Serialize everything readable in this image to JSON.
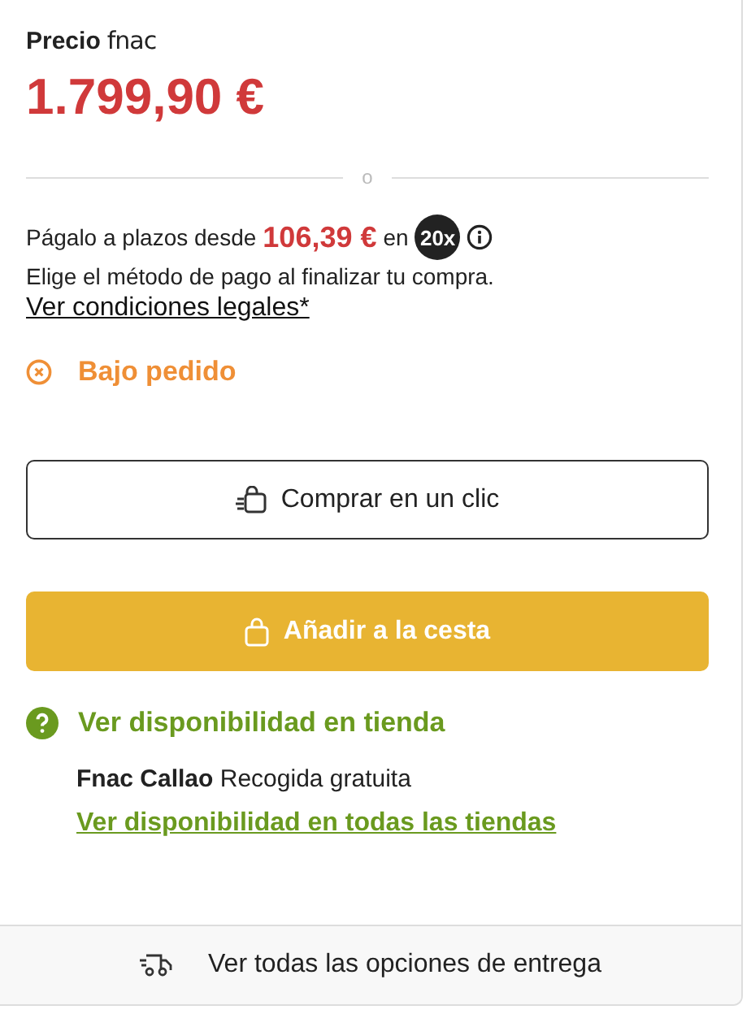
{
  "price": {
    "label": "Precio",
    "brand": "fnac",
    "amount": "1.799,90 €"
  },
  "divider_text": "o",
  "installments": {
    "prefix": "Págalo a plazos desde",
    "amount": "106,39 €",
    "connector": "en",
    "badge": "20x",
    "note": "Elige el método de pago al finalizar tu compra.",
    "link": "Ver condiciones legales*"
  },
  "status": {
    "kind": "backorder",
    "label": "Bajo pedido"
  },
  "buttons": [
    {
      "kind": "outline",
      "label": "Comprar en un clic"
    },
    {
      "kind": "primary",
      "label": "Añadir a la cesta"
    }
  ],
  "store": {
    "title": "Ver disponibilidad en tienda",
    "line": "**Fnac Callao** Recogida gratuita",
    "link": "Ver disponibilidad en todas las tiendas"
  },
  "footer": {
    "label": "Ver todas las opciones de entrega"
  }
}
